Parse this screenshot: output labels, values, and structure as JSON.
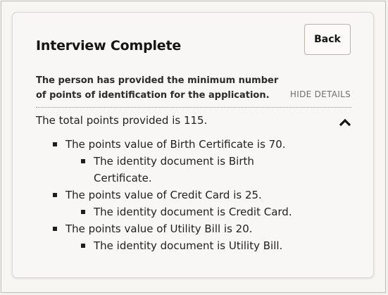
{
  "interview": {
    "title": "Interview Complete",
    "back_label": "Back",
    "summary": "The person has provided the minimum number of points of identification for the application.",
    "hide_details_label": "HIDE DETAILS",
    "total_points_text": "The total points provided is 115.",
    "items": [
      {
        "text": "The points value of Birth Certificate is 70.",
        "detail": "The identity document is Birth Certificate."
      },
      {
        "text": "The points value of Credit Card is 25.",
        "detail": "The identity document is Credit Card."
      },
      {
        "text": "The points value of Utility Bill is 20.",
        "detail": "The identity document is Utility Bill."
      }
    ],
    "collapse_icon": "chevron-up-icon"
  }
}
